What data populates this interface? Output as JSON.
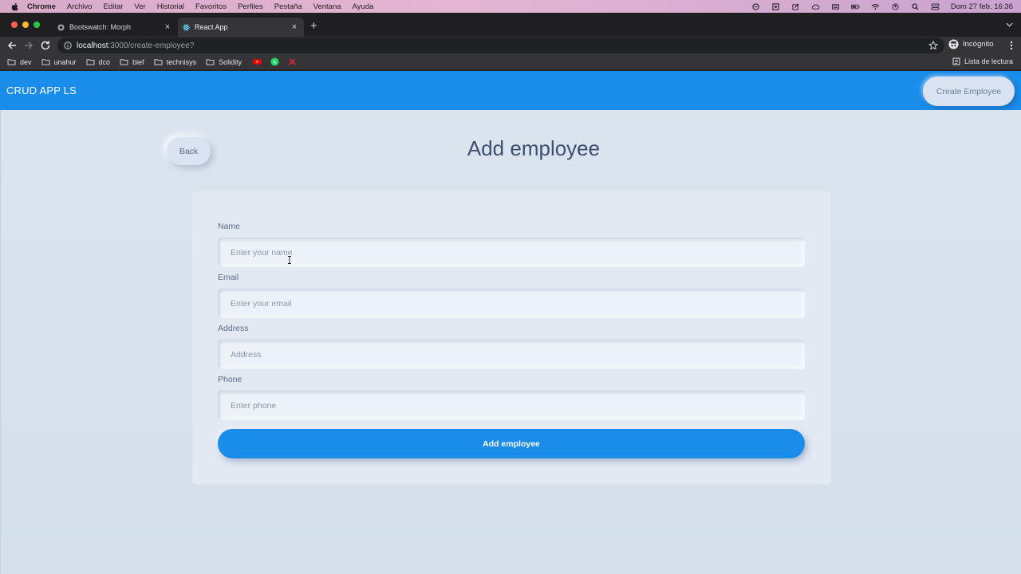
{
  "os_menubar": {
    "app": "Chrome",
    "items": [
      "Archivo",
      "Editar",
      "Ver",
      "Historial",
      "Favoritos",
      "Perfiles",
      "Pestaña",
      "Ventana",
      "Ayuda"
    ],
    "clock": "Dom 27 feb.  16:36"
  },
  "browser": {
    "tabs": [
      {
        "title": "Bootswatch: Morph",
        "active": false
      },
      {
        "title": "React App",
        "active": true
      }
    ],
    "url_host": "localhost",
    "url_path": ":3000/create-employee?",
    "profile_label": "Incógnito",
    "bookmarks": [
      "dev",
      "unahur",
      "dco",
      "bief",
      "technisys",
      "Solidity"
    ],
    "reading_list": "Lista de lectura"
  },
  "app": {
    "brand": "CRUD APP LS",
    "nav_button": "Create Employee",
    "back_button": "Back",
    "page_title": "Add employee",
    "form": {
      "fields": [
        {
          "label": "Name",
          "placeholder": "Enter your name",
          "value": ""
        },
        {
          "label": "Email",
          "placeholder": "Enter your email",
          "value": ""
        },
        {
          "label": "Address",
          "placeholder": "Address",
          "value": ""
        },
        {
          "label": "Phone",
          "placeholder": "Enter phone",
          "value": ""
        }
      ],
      "submit": "Add employee"
    }
  },
  "colors": {
    "primary": "#1a8cea",
    "page_bg": "#d9e3f1",
    "card_bg": "#e2e9f3",
    "title_text": "#3f4d6e"
  }
}
